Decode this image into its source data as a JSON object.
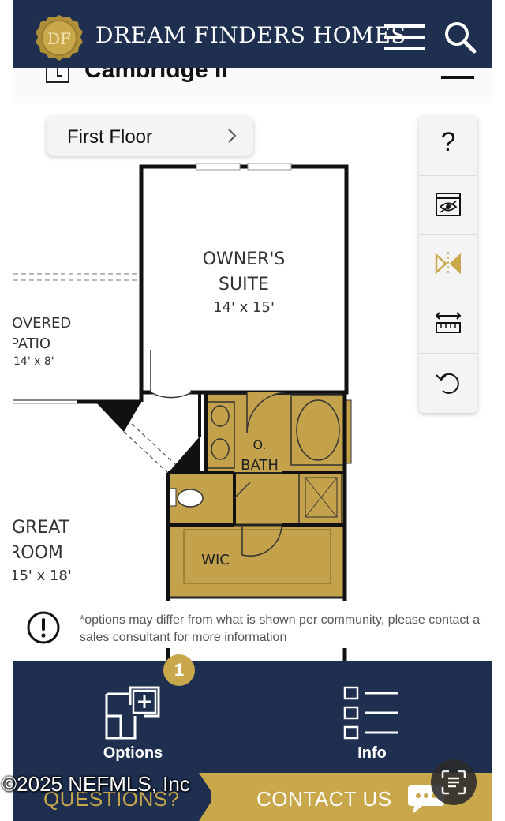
{
  "header": {
    "logo_text": "DF",
    "brand_name": "DREAM FINDERS HOMES"
  },
  "plan": {
    "title": "Cambridge II"
  },
  "floor_selector": {
    "label": "First Floor"
  },
  "tools": {
    "help_label": "?"
  },
  "floorplan": {
    "owners_suite_line1": "OWNER'S",
    "owners_suite_line2": "SUITE",
    "owners_suite_size": "14' x 15'",
    "patio_line1": "OVERED",
    "patio_line2": "PATIO",
    "patio_size": "14' x 8'",
    "great_room_line1": "GREAT",
    "great_room_line2": "ROOM",
    "great_room_size": "15' x 18'",
    "bath_line1": "O.",
    "bath_line2": "BATH",
    "wic_label": "WIC"
  },
  "disclaimer": {
    "text": "*options may differ from what is shown per community, please contact a sales consultant for more information"
  },
  "bottom_nav": {
    "options_label": "Options",
    "options_badge": "1",
    "info_label": "Info"
  },
  "footer": {
    "questions_label": "QUESTIONS?",
    "contact_label": "CONTACT US"
  },
  "watermark": {
    "copyright": "©2025 NEFMLS, Inc"
  },
  "colors": {
    "navy": "#1e2f4f",
    "gold": "#c9a84c",
    "bath_fill": "#c4a24b"
  }
}
